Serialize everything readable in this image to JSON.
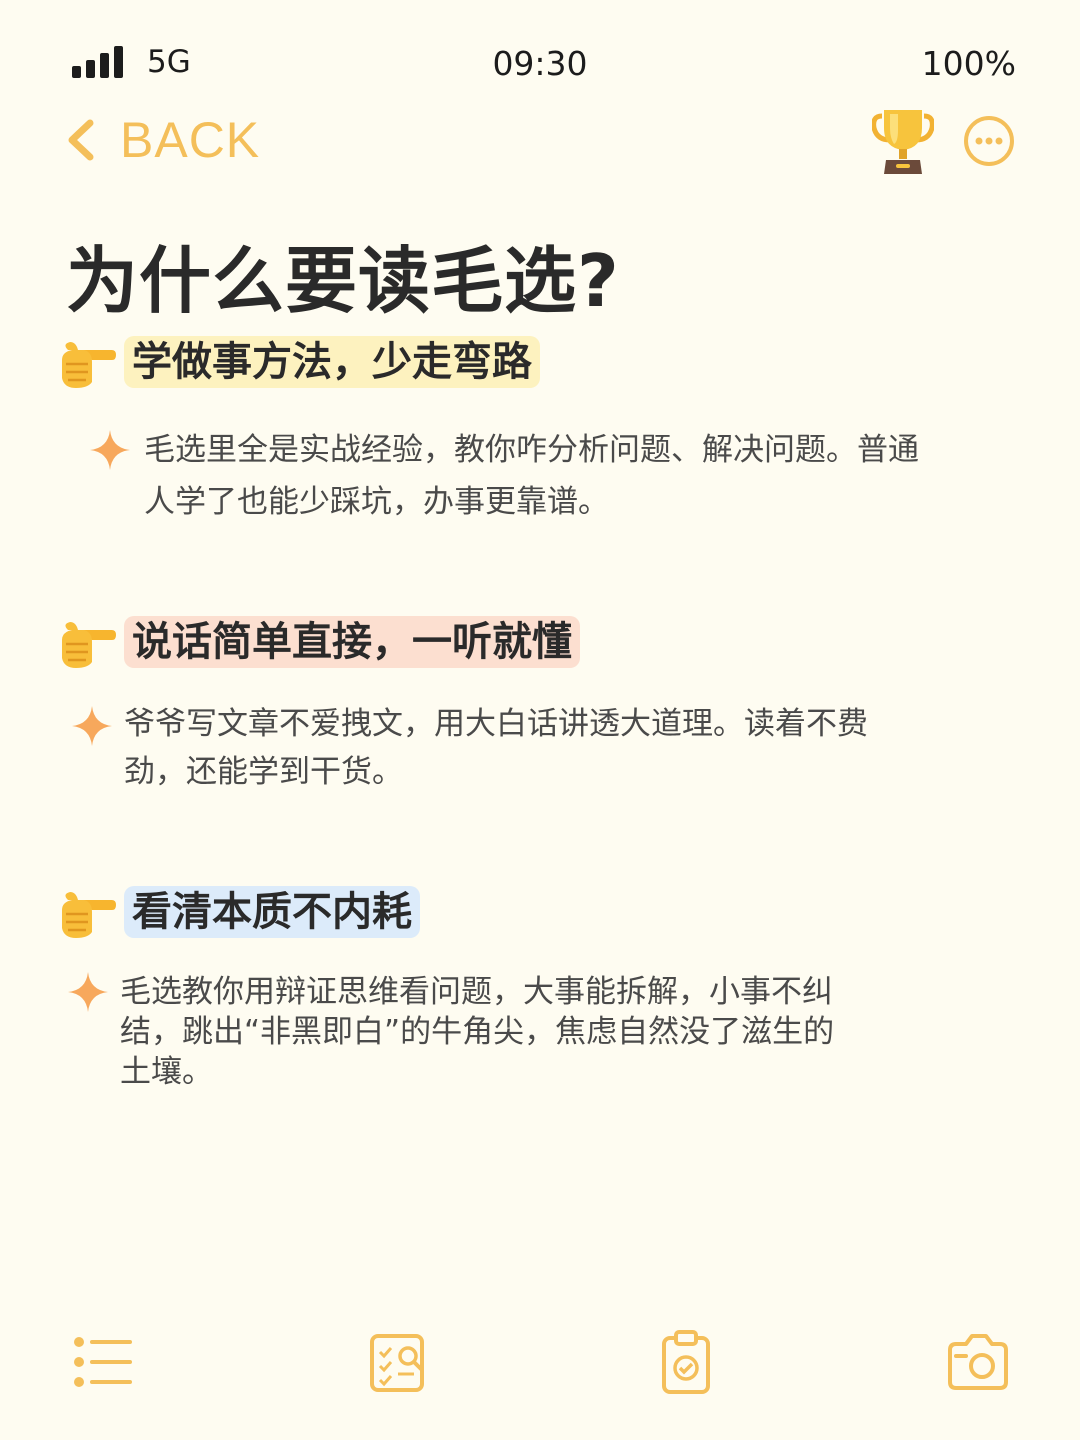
{
  "status_bar": {
    "network": "5G",
    "time": "09:30",
    "battery": "100%"
  },
  "nav": {
    "back_label": "BACK",
    "icons": [
      "chevron-left-icon",
      "trophy-icon",
      "more-icon"
    ]
  },
  "page": {
    "title": "为什么要读毛选?"
  },
  "sections": [
    {
      "heading": "学做事方法，少走弯路",
      "highlight_color": "#fdf2bf",
      "lines": [
        "毛选里全是实战经验，教你咋分析问题、解决问题。普通",
        "人学了也能少踩坑，办事更靠谱。"
      ]
    },
    {
      "heading": "说话简单直接，一听就懂",
      "highlight_color": "#fcdfd0",
      "lines": [
        "爷爷写文章不爱拽文，用大白话讲透大道理。读着不费",
        "劲，还能学到干货。"
      ]
    },
    {
      "heading": "看清本质不内耗",
      "highlight_color": "#dcebfa",
      "lines": [
        "毛选教你用辩证思维看问题，大事能拆解，小事不纠",
        "结，跳出“非黑即白”的牛角尖，焦虑自然没了滋生的",
        "土壤。"
      ]
    }
  ],
  "tab_bar": {
    "icons": [
      "list-icon",
      "checklist-search-icon",
      "clipboard-check-icon",
      "camera-icon"
    ]
  },
  "colors": {
    "accent": "#f4bf5a",
    "background": "#fefcf1",
    "sparkle": "#f7a85c"
  }
}
